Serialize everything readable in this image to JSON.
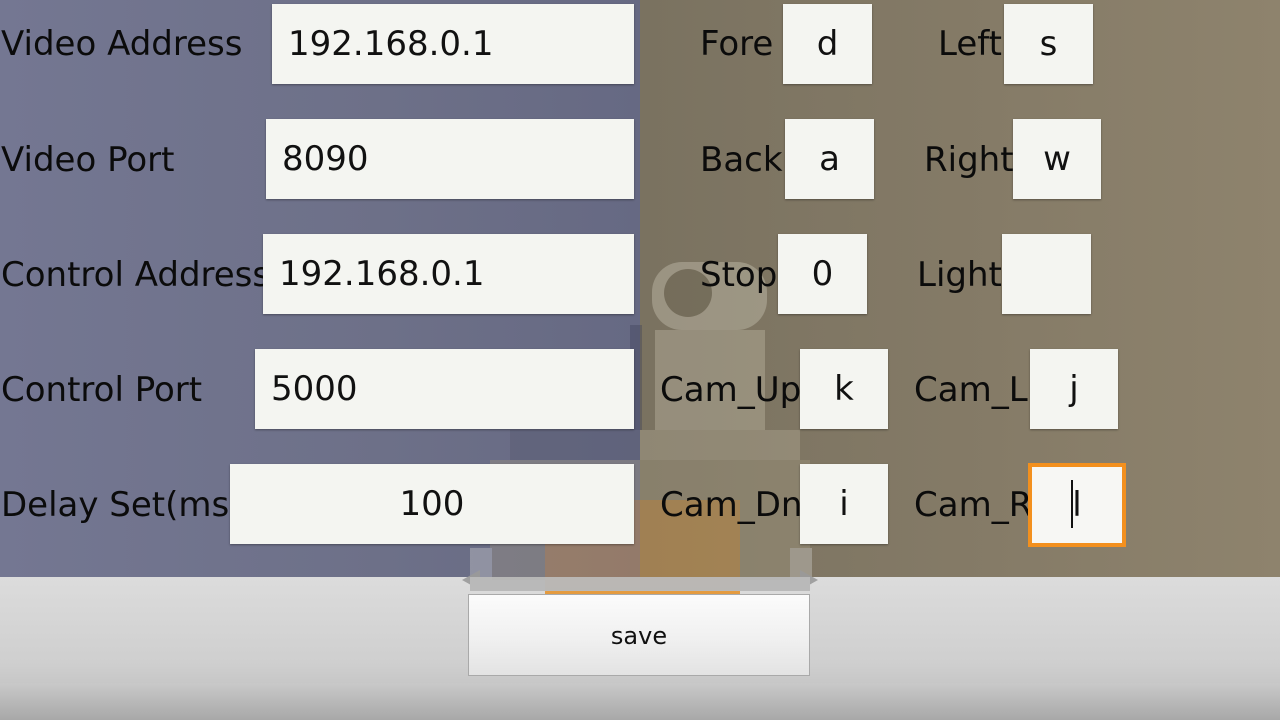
{
  "connection": {
    "video_address": {
      "label": "Video Address",
      "value": "192.168.0.1"
    },
    "video_port": {
      "label": "Video Port",
      "value": "8090"
    },
    "control_address": {
      "label": "Control Address",
      "value": "192.168.0.1"
    },
    "control_port": {
      "label": "Control Port",
      "value": "5000"
    },
    "delay": {
      "label": "Delay Set(ms)",
      "value": "100"
    }
  },
  "keys": {
    "fore": {
      "label": "Fore",
      "value": "d"
    },
    "left": {
      "label": "Left",
      "value": "s"
    },
    "back": {
      "label": "Back",
      "value": "a"
    },
    "right": {
      "label": "Right",
      "value": "w"
    },
    "stop": {
      "label": "Stop",
      "value": "0"
    },
    "light": {
      "label": "Light",
      "value": ""
    },
    "cam_up": {
      "label": "Cam_Up",
      "value": "k"
    },
    "cam_l": {
      "label": "Cam_L",
      "value": "j"
    },
    "cam_dn": {
      "label": "Cam_Dn",
      "value": "i"
    },
    "cam_r": {
      "label": "Cam_R",
      "value": "l"
    }
  },
  "save_label": "save",
  "colors": {
    "focus_border": "#f3901e",
    "field_bg": "#f4f5f1"
  }
}
